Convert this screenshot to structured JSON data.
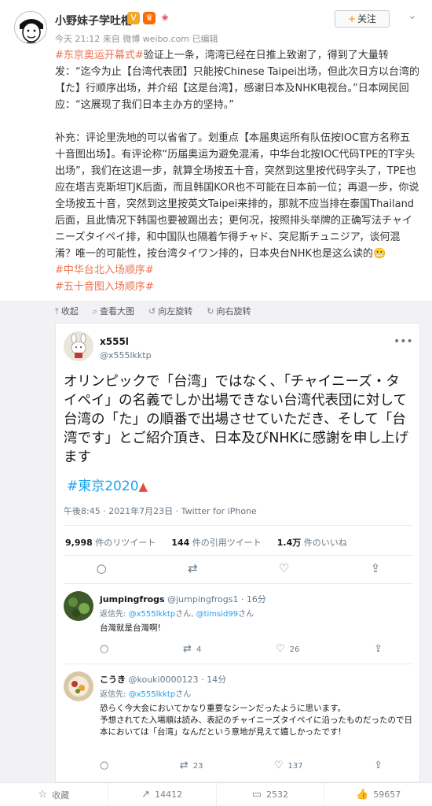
{
  "post": {
    "username": "小野妹子学吐槽",
    "meta": "今天 21:12 来自 微博 weibo.com   已编辑",
    "follow_label": "关注",
    "para1_tag": "#东京奥运开幕式#",
    "para1_text": "验证上一条，湾湾已经在日推上致谢了，得到了大量转发：“迄今为止【台湾代表团】只能按Chinese Taipei出场，但此次日方以台湾的【た】行顺序出场，并介绍【这是台湾】，感谢日本及NHK电视台。”日本网民回应：“这展现了我们日本主办方的坚持。”",
    "para2_text": "补充：评论里洗地的可以省省了。划重点【本届奥运所有队伍按IOC官方名称五十音图出场】。有评论称“历届奥运为避免混淆，中华台北按IOC代码TPE的T字头出场”，我们在这退一步，就算全场按五十音，突然到这里按代码字头了，TPE也应在塔吉克斯坦TJK后面，而且韩国KOR也不可能在日本前一位；再退一步，你说全场按五十音，突然到这里按英文Taipei来排的，那就不应当排在泰国Thailand后面，且此情况下韩国也要被踢出去；更何况，按照排头举牌的正确写法チャイニーズタイペイ排，和中国队也隔着乍得チャド、突尼斯チュニジア，谈何混淆？唯一的可能性，按台湾タイワン排的，日本央台NHK也是这么读的",
    "tag2": "#中华台北入场顺序#",
    "tag3": "#五十音图入场顺序#"
  },
  "imagebar": {
    "collapse": "收起",
    "view_large": "查看大图",
    "rotate_left": "向左旋转",
    "rotate_right": "向右旋转"
  },
  "tweet": {
    "name": "x555l",
    "handle": "@x555lkktp",
    "text": "オリンピックで「台湾」ではなく、「チャイニーズ・タイペイ」の名義でしか出場できない台湾代表団に対して台湾の「た」の順番で出場させていただき、そして「台湾です」とご紹介頂き、日本及びNHKに感謝を申し上げます",
    "hashtag": "#東京2020",
    "date": "午後8:45 · 2021年7月23日 · Twitter for iPhone",
    "retweets_num": "9,998",
    "retweets_label": "件のリツイート",
    "quotes_num": "144",
    "quotes_label": "件の引用ツイート",
    "likes_num": "1.4万",
    "likes_label": "件のいいね"
  },
  "replies": [
    {
      "name": "jumpingfrogs",
      "handle": "@jumpingfrogs1 · 16分",
      "to_prefix": "返信先: ",
      "to_link": "@x555lkktp",
      "to_mid": "さん, ",
      "to_link2": "@timsid99",
      "to_suffix": "さん",
      "text": "台灣就是台灣啊!",
      "retweets": "4",
      "likes": "26"
    },
    {
      "name": "こうき",
      "handle": "@kouki0000123 · 14分",
      "to_prefix": "返信先: ",
      "to_link": "@x555lkktp",
      "to_suffix": "さん",
      "text": "恐らく今大会においてかなり重要なシーンだったように思います。\n予想されてた入場順は読み、表記のチャイニーズタイペイに沿ったものだったので日本においては「台湾」なんだという意地が見えて嬉しかったです!",
      "retweets": "23",
      "likes": "137"
    }
  ],
  "bottombar": {
    "collapse": "收藏",
    "repost": "14412",
    "comment": "2532",
    "like": "59657"
  }
}
